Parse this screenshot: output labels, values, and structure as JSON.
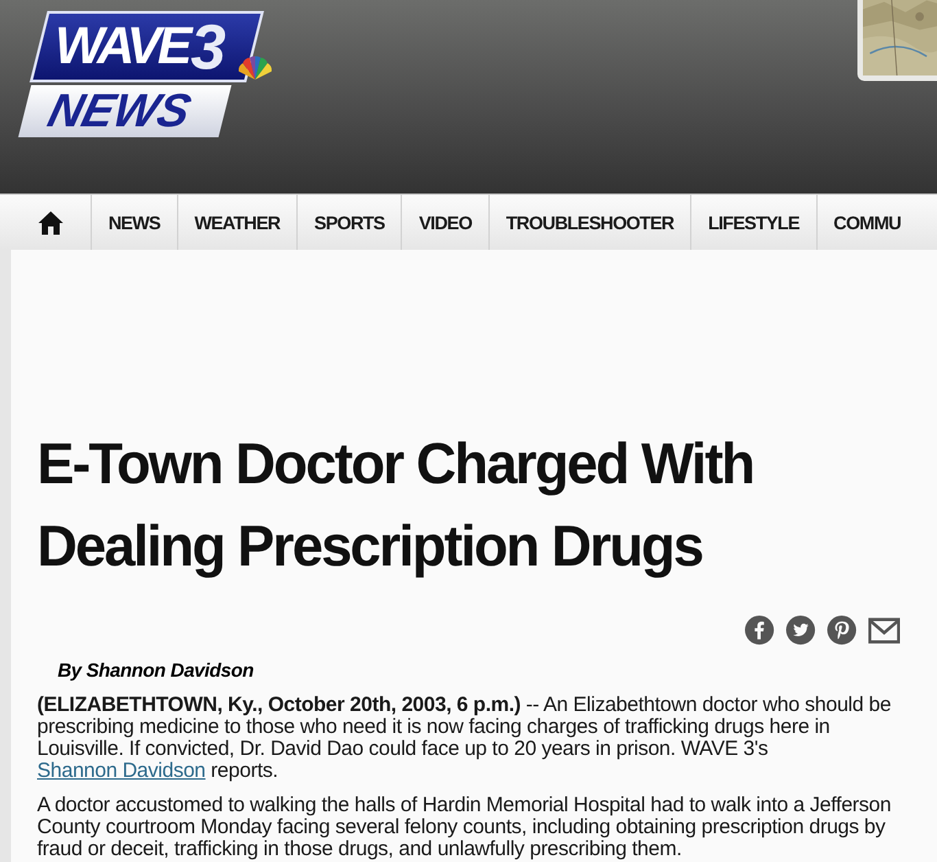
{
  "header": {
    "logo": {
      "top": "WAVE",
      "number": "3",
      "bottom": "NEWS"
    }
  },
  "nav": {
    "items": [
      {
        "label": "NEWS"
      },
      {
        "label": "WEATHER"
      },
      {
        "label": "SPORTS"
      },
      {
        "label": "VIDEO"
      },
      {
        "label": "TROUBLESHOOTER"
      },
      {
        "label": "LIFESTYLE"
      },
      {
        "label": "COMMU"
      }
    ]
  },
  "article": {
    "headline": "E-Town Doctor Charged With Dealing Prescription Drugs",
    "share": [
      {
        "kind": "facebook"
      },
      {
        "kind": "twitter"
      },
      {
        "kind": "pinterest"
      },
      {
        "kind": "email"
      }
    ],
    "byline": "By Shannon Davidson",
    "paragraphs": [
      {
        "text": "**(ELIZABETHTOWN, Ky., October 20th, 2003, 6 p.m.)** -- An Elizabethtown doctor who should be prescribing medicine to those who need it is now facing charges of trafficking drugs here in Louisville. If convicted, Dr. David Dao could face up to 20 years in prison. WAVE 3's",
        "link": "Shannon Davidson",
        "after": "reports."
      },
      {
        "text": "A doctor accustomed to walking the halls of Hardin Memorial Hospital had to walk into a Jefferson County courtroom Monday facing several felony counts, including obtaining prescription drugs by fraud or deceit, trafficking in those drugs, and unlawfully prescribing them."
      }
    ]
  }
}
